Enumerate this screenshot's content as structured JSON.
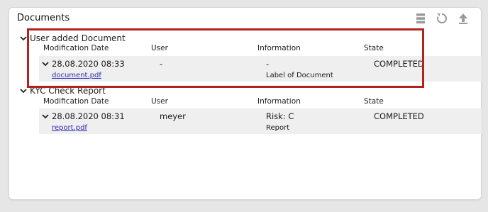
{
  "panel": {
    "title": "Documents",
    "toolbar": {
      "list_icon": "list-icon",
      "refresh_icon": "refresh-icon",
      "upload_icon": "upload-icon"
    }
  },
  "columns": {
    "date": "Modification Date",
    "user": "User",
    "information": "Information",
    "state": "State"
  },
  "groups": [
    {
      "title": "User added Document",
      "row": {
        "date": "28.08.2020 08:33",
        "user": "-",
        "information": "-",
        "state": "COMPLETED",
        "file": "document.pdf",
        "detail": "Label of Document"
      }
    },
    {
      "title": "KYC Check Report",
      "row": {
        "date": "28.08.2020 08:31",
        "user": "meyer",
        "information": "Risk: C",
        "state": "COMPLETED",
        "file": "report.pdf",
        "detail": "Report"
      }
    }
  ],
  "colors": {
    "highlight_border": "#b3231d",
    "link": "#2b2bb6",
    "row_bg": "#efefef"
  }
}
